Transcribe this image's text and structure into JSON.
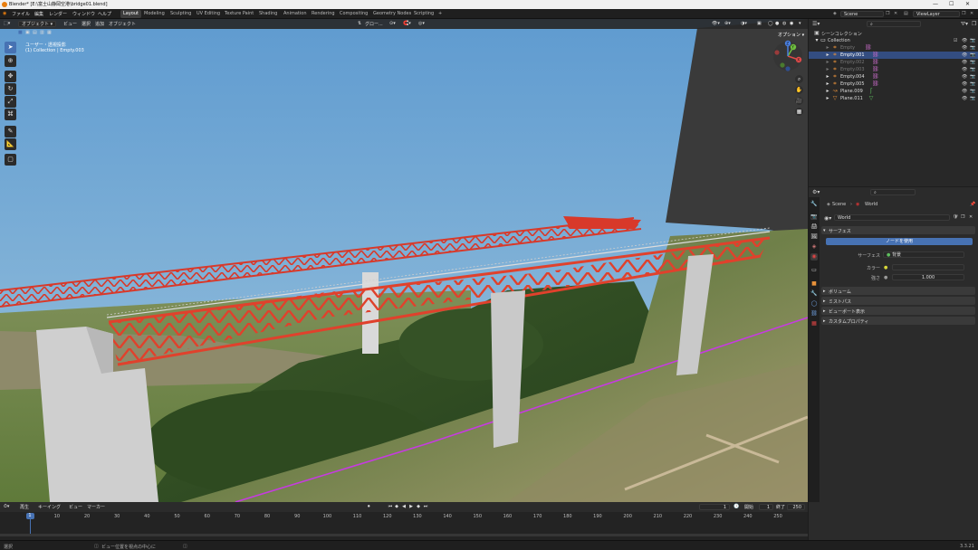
{
  "window": {
    "title": "Blender* [E:\\富士山静岡空港\\bridge01.blend]",
    "controls": [
      "—",
      "☐",
      "✕"
    ]
  },
  "menus": [
    "ファイル",
    "編集",
    "レンダー",
    "ウィンドウ",
    "ヘルプ"
  ],
  "workspaces": [
    "Layout",
    "Modeling",
    "Sculpting",
    "UV Editing",
    "Texture Paint",
    "Shading",
    "Animation",
    "Rendering",
    "Compositing",
    "Geometry Nodes",
    "Scripting"
  ],
  "workspace_add": "+",
  "scene_field": "Scene",
  "viewlayer_field": "ViewLayer",
  "viewport": {
    "mode": "オブジェクト",
    "menu": [
      "ビュー",
      "選択",
      "追加",
      "オブジェクト"
    ],
    "transform": "グロー...",
    "overlay_info_line1": "ユーザー・透視投影",
    "overlay_info_line2": "(1) Collection | Empty.003",
    "options_label": "オプション",
    "gizmo": {
      "x": "X",
      "y": "Y",
      "z": "Z"
    }
  },
  "outliner": {
    "root": "シーンコレクション",
    "collection": "Collection",
    "items": [
      {
        "name": "Empty",
        "dim": true
      },
      {
        "name": "Empty.001",
        "selected": true
      },
      {
        "name": "Empty.002",
        "dim": true
      },
      {
        "name": "Empty.003",
        "dim": true
      },
      {
        "name": "Empty.004"
      },
      {
        "name": "Empty.005"
      },
      {
        "name": "Plane.009"
      },
      {
        "name": "Plane.011"
      }
    ]
  },
  "properties": {
    "breadcrumb_scene": "Scene",
    "breadcrumb_world": "World",
    "world_name": "World",
    "panel_surface": "サーフェス",
    "use_nodes": "ノードを使用",
    "surface_label": "サーフェス",
    "surface_value": "背景",
    "color_label": "カラー",
    "strength_label": "強さ",
    "strength_value": "1.000",
    "panels": [
      "ボリューム",
      "ミストパス",
      "ビューポート表示",
      "カスタムプロパティ"
    ]
  },
  "timeline": {
    "menu": [
      "再生",
      "キーイング",
      "ビュー",
      "マーカー"
    ],
    "current_frame": "1",
    "start_label": "開始",
    "start_value": "1",
    "end_label": "終了",
    "end_value": "250",
    "ticks": [
      "1",
      "10",
      "20",
      "30",
      "40",
      "50",
      "60",
      "70",
      "80",
      "90",
      "100",
      "110",
      "120",
      "130",
      "140",
      "150",
      "160",
      "170",
      "180",
      "190",
      "200",
      "210",
      "220",
      "230",
      "240",
      "250"
    ]
  },
  "statusbar": {
    "left": "選択",
    "middle": "ビュー位置を視点の中心に",
    "version": "3.3.21"
  },
  "colors": {
    "accent": "#4772b3",
    "bridge": "#d83a2a",
    "sky": "#6da3cf"
  }
}
